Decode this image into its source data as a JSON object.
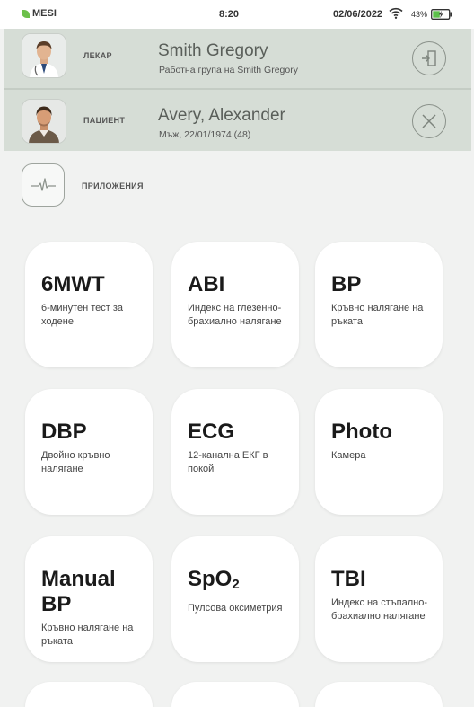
{
  "status_bar": {
    "brand": "MESI",
    "time": "8:20",
    "date": "02/06/2022",
    "battery": "43%",
    "brand_color": "#6cc04a"
  },
  "doctor": {
    "label": "ЛЕКАР",
    "name": "Smith Gregory",
    "subtitle": "Работна група на Smith Gregory",
    "action_icon": "logout-icon"
  },
  "patient": {
    "label": "ПАЦИЕНТ",
    "name": "Avery, Alexander",
    "subtitle": "Мъж, 22/01/1974 (48)",
    "action_icon": "close-icon"
  },
  "apps": {
    "label": "ПРИЛОЖЕНИЯ",
    "icon": "ecg-wave-icon",
    "tiles": [
      {
        "title": "6MWT",
        "desc": "6-минутен тест за ходене"
      },
      {
        "title": "ABI",
        "desc": "Индекс на глезенно-брахиално налягане"
      },
      {
        "title": "BP",
        "desc": "Кръвно налягане на ръката"
      },
      {
        "title": "DBP",
        "desc": "Двойно кръвно налягане"
      },
      {
        "title": "ECG",
        "desc": "12-канална ЕКГ в покой"
      },
      {
        "title": "Photo",
        "desc": "Камера"
      },
      {
        "title": "Manual BP",
        "desc": "Кръвно налягане на ръката"
      },
      {
        "title_main": "SpO",
        "title_sub": "2",
        "desc": "Пулсова оксиметрия"
      },
      {
        "title": "TBI",
        "desc": "Индекс на стъпално-брахиално налягане"
      }
    ]
  }
}
